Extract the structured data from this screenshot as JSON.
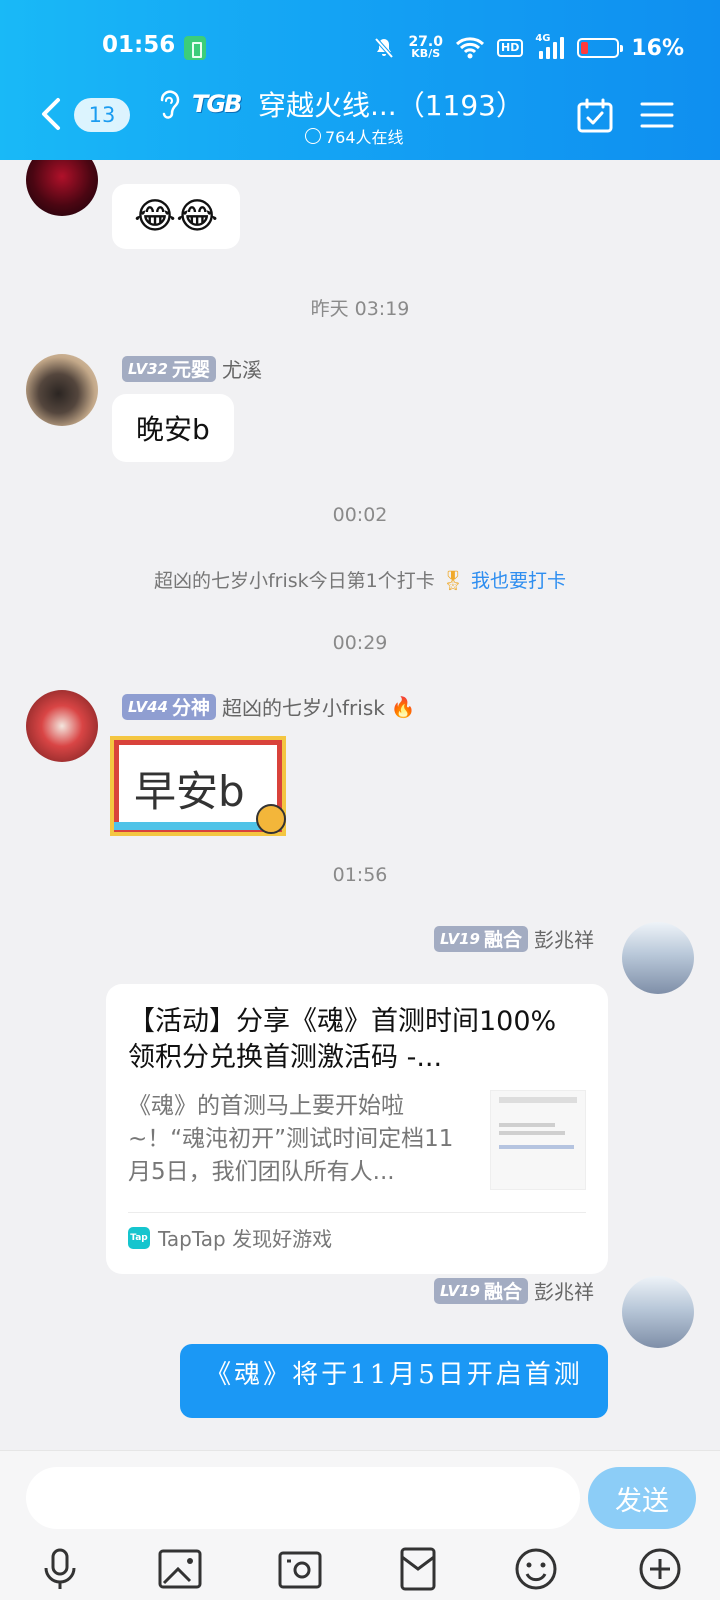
{
  "status_bar": {
    "time": "01:56",
    "net_speed_value": "27.0",
    "net_speed_unit": "KB/S",
    "hd_label": "HD",
    "network_type": "4G",
    "battery_percent": "16%"
  },
  "nav": {
    "unread_count": "13",
    "group_logo": "TGB",
    "group_title": "穿越火线...（1193）",
    "online_text": "764人在线"
  },
  "messages": {
    "m1_bubble": "😂😂",
    "ts1": "昨天 03:19",
    "m2_level": "LV32",
    "m2_title": "元婴",
    "m2_name": "尤溪",
    "m2_text": "晚安b",
    "ts2": "00:02",
    "sys_checkin_text": "超凶的七岁小frisk今日第1个打卡",
    "sys_checkin_link": "我也要打卡",
    "ts3": "00:29",
    "m3_level": "LV44",
    "m3_title": "分神",
    "m3_name": "超凶的七岁小frisk",
    "m3_sticker_text": "早安b",
    "ts4": "01:56",
    "m4_level": "LV19",
    "m4_title": "融合",
    "m4_name": "彭兆祥",
    "m5_level": "LV19",
    "m5_title": "融合",
    "m5_name": "彭兆祥",
    "m5_text": "《魂》将于11月5日开启首测"
  },
  "share_card": {
    "title": "【活动】分享《魂》首测时间100%领积分兑换首测激活码 -...",
    "description": "《魂》的首测马上要开始啦~！“魂沌初开”测试时间定档11月5日，我们团队所有人...",
    "source_icon": "Tap",
    "source": "TapTap 发现好游戏"
  },
  "input": {
    "placeholder": "",
    "send_label": "发送"
  },
  "icons": [
    "voice-icon",
    "image-icon",
    "camera-icon",
    "red-packet-icon",
    "emoji-icon",
    "plus-icon"
  ],
  "colors": {
    "header_blue": "#139ff3",
    "bubble_blue": "#1b98f5",
    "send_button": "#8ccdf7",
    "level_badge": "#a3acc2",
    "link": "#2e8ef0"
  }
}
